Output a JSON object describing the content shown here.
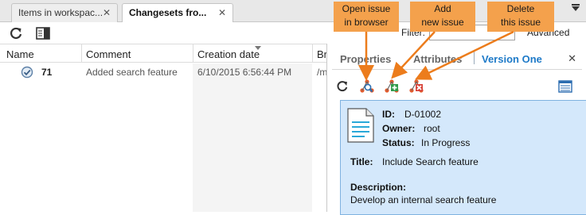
{
  "tabs": [
    {
      "label": "Items in workspac...",
      "close": "✕"
    },
    {
      "label": "Changesets fro...",
      "close": "✕"
    }
  ],
  "toolbar": {
    "refresh_icon": "refresh-icon",
    "layout_icon": "panel-layout-icon",
    "filter_label": "Filter:",
    "filter_value": "",
    "advanced_label": "Advanced"
  },
  "table": {
    "columns": [
      "Name",
      "Comment",
      "Creation date",
      "Br"
    ],
    "sorted_column": "Creation date",
    "rows": [
      {
        "name": "71",
        "comment": "Added search feature",
        "date": "6/10/2015 6:56:44 PM",
        "branch": "/m"
      }
    ]
  },
  "side_panel": {
    "tabs": [
      "Properties",
      "Attributes",
      "Version One"
    ],
    "active_tab": "Version One",
    "close": "✕",
    "toolbar_icons": [
      "refresh-icon",
      "open-in-browser-icon",
      "add-issue-icon",
      "delete-issue-icon",
      "view-options-icon"
    ],
    "issue": {
      "id_label": "ID:",
      "id": "D-01002",
      "owner_label": "Owner:",
      "owner": "root",
      "status_label": "Status:",
      "status": "In Progress",
      "title_label": "Title:",
      "title": "Include Search feature",
      "description_label": "Description:",
      "description": "Develop an internal search feature"
    }
  },
  "callouts": {
    "open_issue": [
      "Open issue",
      "in browser"
    ],
    "add_issue": [
      "Add",
      "new issue"
    ],
    "delete_issue": [
      "Delete",
      "this issue"
    ],
    "color": "#f4a14c"
  },
  "colors": {
    "accent_blue": "#1e7ac8",
    "card_bg": "#d4e8fb",
    "card_border": "#7fb2e0"
  }
}
